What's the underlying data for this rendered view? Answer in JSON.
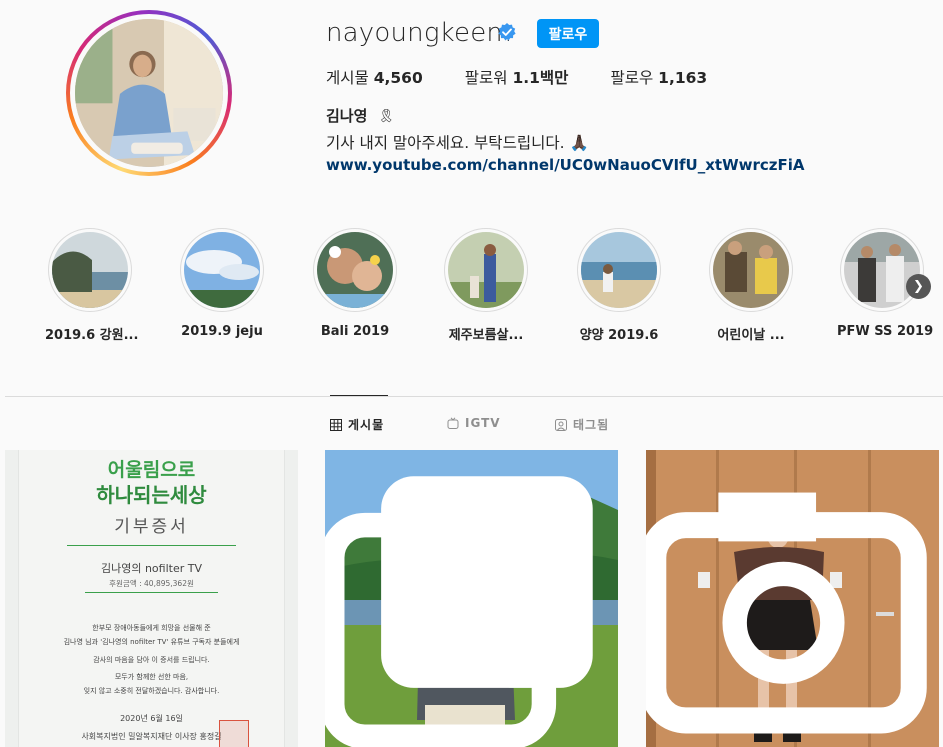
{
  "profile": {
    "username": "nayoungkeem",
    "follow_label": "팔로우",
    "stats": {
      "posts_label": "게시물",
      "posts_value": "4,560",
      "followers_label": "팔로워",
      "followers_value": "1.1백만",
      "following_label": "팔로우",
      "following_value": "1,163"
    },
    "full_name": "김나영",
    "bio": "기사 내지 말아주세요. 부탁드립니다. 🙏🏿",
    "link": "www.youtube.com/channel/UC0wNauoCVIfU_xtWwrczFiA",
    "verified": true
  },
  "highlights": [
    {
      "label": "2019.6 강원..."
    },
    {
      "label": "2019.9 jeju"
    },
    {
      "label": "Bali 2019"
    },
    {
      "label": "제주보름살..."
    },
    {
      "label": "양양 2019.6"
    },
    {
      "label": "어린이날 ..."
    },
    {
      "label": "PFW SS 2019"
    }
  ],
  "tabs": [
    {
      "label": "게시물",
      "icon": "grid-icon",
      "active": true
    },
    {
      "label": "IGTV",
      "icon": "igtv-icon",
      "active": false
    },
    {
      "label": "태그됨",
      "icon": "tagged-icon",
      "active": false
    }
  ],
  "posts": [
    {
      "type": "image",
      "certificate": {
        "logo_line1": "어울림으로",
        "logo_line2": "하나되는세상",
        "title": "기부증서",
        "name": "김나영의 nofilter TV",
        "amount": "후원금액 : 40,895,362원",
        "lines": [
          "한부모 장애아동들에게 희망을 선물해 준",
          "김나영 님과 '김나영의 nofilter TV' 유튜브 구독자 분들에게",
          "감사의 마음을 담아 이 증서를 드립니다.",
          "모두가 함께한 선한 마음,",
          "잊지 않고 소중히 전달하겠습니다. 감사합니다."
        ],
        "date": "2020년 6월 16일",
        "signature": "사회복지법인 밀알복지재단 이사장 홍정길"
      }
    },
    {
      "type": "carousel",
      "badge_icon": "carousel-icon"
    },
    {
      "type": "video",
      "badge_icon": "video-icon"
    }
  ],
  "colors": {
    "accent": "#0095f6",
    "link": "#00376b",
    "text": "#262626",
    "muted": "#8e8e8e",
    "background": "#fafafa"
  }
}
